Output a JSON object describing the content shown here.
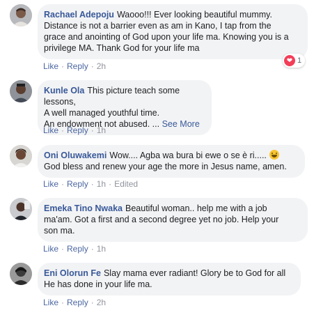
{
  "comments": [
    {
      "author": "Rachael Adepoju",
      "lines": [
        "Waooo!!! Ever looking beautiful mummy.",
        "Distance is not a barrier even as am in Kano, I tap from the",
        "grace and anointing of God upon your life ma. Knowing you is a",
        "privilege MA. Thank God for your life ma"
      ],
      "actions": {
        "like": "Like",
        "reply": "Reply",
        "time": "2h"
      },
      "reaction": {
        "icon": "heart-reaction-icon",
        "count": "1",
        "color": "#f33e58"
      }
    },
    {
      "author": "Kunle Ola",
      "lines": [
        "This picture teach some lessons,",
        "A well managed youthful time.",
        "An endowment not abused. ..."
      ],
      "see_more": "See More",
      "actions": {
        "like": "Like",
        "reply": "Reply",
        "time": "1h"
      }
    },
    {
      "author": "Oni Oluwakemi",
      "lines": [
        "Wow.... Agba wa bura bi ewe o se è ri.....",
        "God bless and renew your age the more in Jesus name, amen."
      ],
      "emoji": "grinning-face-emoji",
      "actions": {
        "like": "Like",
        "reply": "Reply",
        "time": "1h",
        "edited": "Edited"
      }
    },
    {
      "author": "Emeka Tino Nwaka",
      "lines": [
        "Beautiful woman.. help me with a job",
        "ma'am. Got a first and a second degree yet no job. Help your",
        "son ma."
      ],
      "actions": {
        "like": "Like",
        "reply": "Reply",
        "time": "1h"
      }
    },
    {
      "author": "Eni Olorun Fe",
      "lines": [
        "Slay mama ever radiant! Glory be to God for all",
        "He has done in your life ma."
      ],
      "actions": {
        "like": "Like",
        "reply": "Reply",
        "time": "2h"
      }
    }
  ],
  "colors": {
    "author": "#385898",
    "bubble": "#f2f3f5",
    "action_link": "#4b67a1",
    "meta": "#90949c"
  }
}
